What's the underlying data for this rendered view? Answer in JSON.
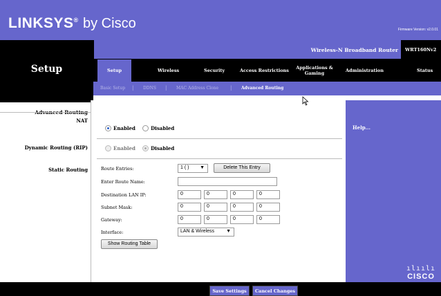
{
  "header": {
    "brand": "LINKSYS",
    "brand_by": "by Cisco",
    "firmware": "Firmware Version: v2.0.01",
    "product_name": "Wireless-N Broadband Router",
    "model": "WRT160Nv2"
  },
  "left_title": "Setup",
  "main_tabs": [
    {
      "label": "Setup"
    },
    {
      "label": "Wireless"
    },
    {
      "label": "Security"
    },
    {
      "label": "Access Restrictions"
    },
    {
      "label": "Applications & Gaming"
    },
    {
      "label": "Administration"
    },
    {
      "label": "Status"
    }
  ],
  "sub_tabs": [
    {
      "label": "Basic Setup"
    },
    {
      "label": "DDNS"
    },
    {
      "label": "MAC Address Clone"
    },
    {
      "label": "Advanced Routing"
    }
  ],
  "sidebar": {
    "section": "Advanced Routing",
    "nat": "NAT",
    "rip": "Dynamic Routing (RIP)",
    "static": "Static Routing"
  },
  "nat": {
    "enabled_label": "Enabled",
    "disabled_label": "Disabled",
    "selected": "enabled"
  },
  "rip": {
    "enabled_label": "Enabled",
    "disabled_label": "Disabled",
    "selected": "disabled"
  },
  "static": {
    "route_entries_label": "Route Entries:",
    "route_entry_value": "1 ( )",
    "delete_button": "Delete This Entry",
    "route_name_label": "Enter Route Name:",
    "route_name_value": "",
    "dest_ip_label": "Destination LAN IP:",
    "dest_ip": [
      "0",
      "0",
      "0",
      "0"
    ],
    "subnet_label": "Subnet Mask:",
    "subnet": [
      "0",
      "0",
      "0",
      "0"
    ],
    "gateway_label": "Gateway:",
    "gateway": [
      "0",
      "0",
      "0",
      "0"
    ],
    "interface_label": "Interface:",
    "interface_value": "LAN & Wireless",
    "show_table_button": "Show Routing Table"
  },
  "help": {
    "link": "Help..."
  },
  "footer": {
    "save": "Save Settings",
    "cancel": "Cancel Changes",
    "cisco_bars": "ılıılı",
    "cisco_word": "CISCO"
  },
  "colors": {
    "accent": "#6666cc",
    "dark": "#000000"
  }
}
